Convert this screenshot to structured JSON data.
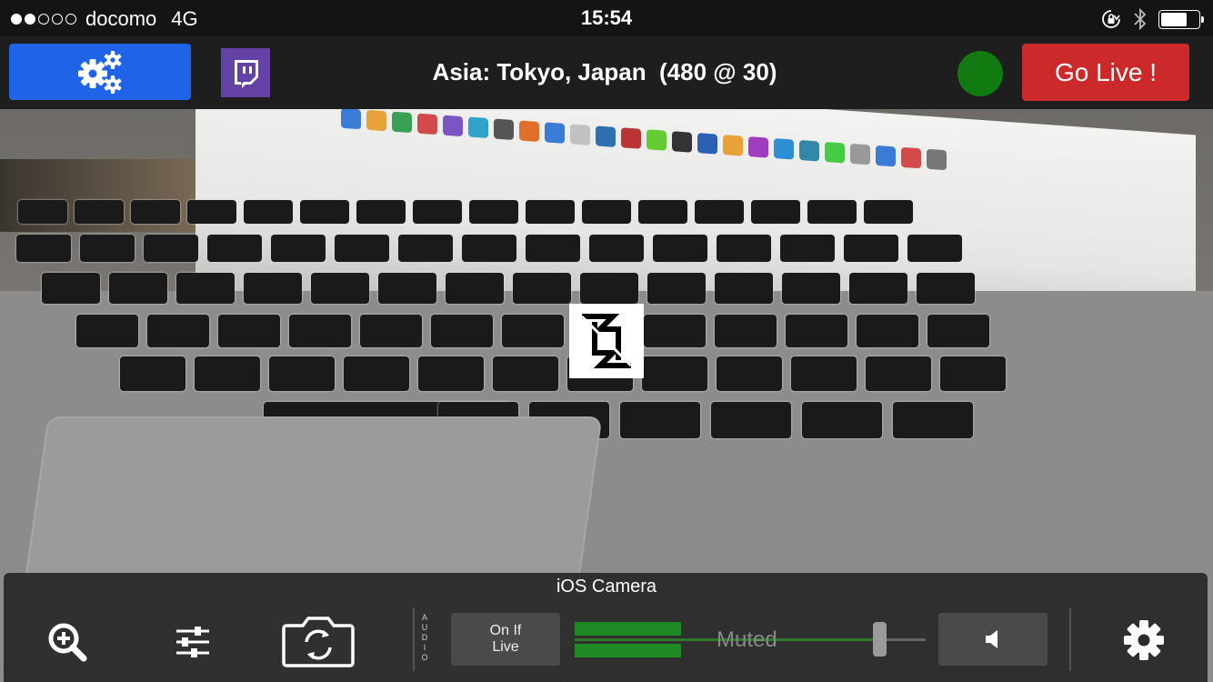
{
  "status_bar": {
    "carrier": "docomo",
    "network": "4G",
    "time": "15:54",
    "signal_bars_filled": 2,
    "signal_bars_total": 5,
    "battery_level": 0.7
  },
  "toolbar": {
    "settings_icon": "gears-icon",
    "twitch_icon": "twitch-icon",
    "server_title": "Asia: Tokyo, Japan  (480 @ 30)",
    "status_color": "#117a11",
    "go_live_label": "Go Live !"
  },
  "preview": {
    "focus_icon": "refocus-icon"
  },
  "bottom_panel": {
    "source_label": "iOS Camera",
    "zoom_icon": "zoom-in-icon",
    "adjust_icon": "sliders-icon",
    "switch_camera_icon": "camera-switch-icon",
    "audio_label_letters": [
      "A",
      "U",
      "D",
      "I",
      "O"
    ],
    "audio_mode_line1": "On If",
    "audio_mode_line2": "Live",
    "volume_label": "Muted",
    "speaker_icon": "speaker-icon",
    "settings_icon": "gear-icon"
  },
  "colors": {
    "settings_button": "#1f63e8",
    "twitch_purple": "#6441a5",
    "go_live_red": "#cc2a2a",
    "meter_green": "#1d8a24"
  }
}
